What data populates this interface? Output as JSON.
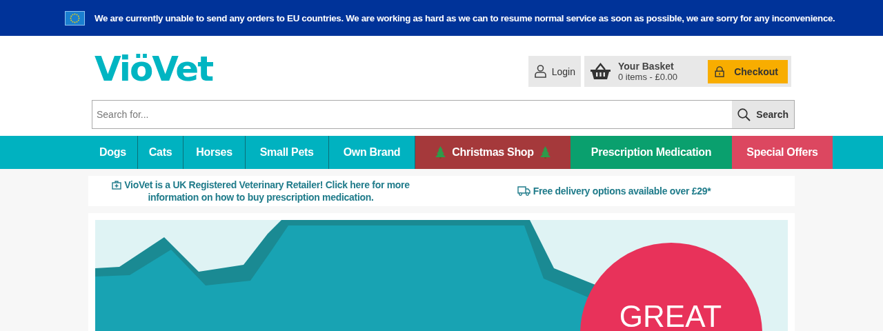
{
  "notice_bar": {
    "text": "We are currently unable to send any orders to EU countries. We are working as hard as we can to resume normal service as soon as possible, we are sorry for any inconvenience."
  },
  "header": {
    "logo": "ViöVet",
    "login": "Login",
    "basket": {
      "title": "Your Basket",
      "summary": "0 items - £0.00"
    },
    "checkout": "Checkout"
  },
  "search": {
    "placeholder": "Search for...",
    "button": "Search"
  },
  "nav": [
    {
      "label": "Dogs",
      "color": "#00b2c0",
      "kind": "plain"
    },
    {
      "label": "Cats",
      "color": "#00b2c0",
      "kind": "plain"
    },
    {
      "label": "Horses",
      "color": "#00b2c0",
      "kind": "plain"
    },
    {
      "label": "Small Pets",
      "color": "#00b2c0",
      "kind": "plain"
    },
    {
      "label": "Own Brand",
      "color": "#00b2c0",
      "kind": "plain"
    },
    {
      "label": "Christmas Shop",
      "color": "#a5393b",
      "kind": "festive"
    },
    {
      "label": "Prescription Medication",
      "color": "#0aa06e",
      "kind": "plain"
    },
    {
      "label": "Special Offers",
      "color": "#dc4760",
      "kind": "plain"
    }
  ],
  "info_strip": [
    {
      "text": "VioVet is a UK Registered Veterinary Retailer! Click here for more information on how to buy prescription medication.",
      "kind": "medical"
    },
    {
      "text": "Free delivery options available over £29*",
      "kind": "delivery"
    }
  ],
  "banner": {
    "badge": "GREAT"
  }
}
